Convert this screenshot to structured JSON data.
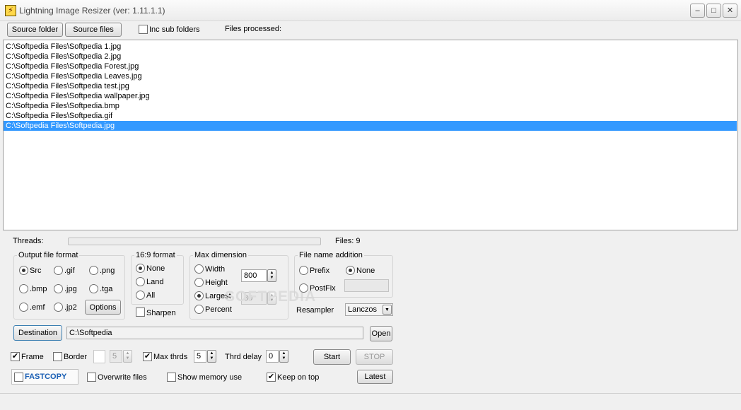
{
  "window": {
    "title": "Lightning Image Resizer (ver: 1.11.1.1)",
    "app_icon_glyph": "⚡",
    "minimize_glyph": "–",
    "maximize_glyph": "□",
    "close_glyph": "✕"
  },
  "toolbar": {
    "source_folder_label": "Source folder",
    "source_files_label": "Source files",
    "inc_sub_folders_label": "Inc sub folders",
    "inc_sub_folders_checked": false,
    "files_processed_label": "Files processed:"
  },
  "file_list": {
    "items": [
      "C:\\Softpedia Files\\Softpedia 1.jpg",
      "C:\\Softpedia Files\\Softpedia 2.jpg",
      "C:\\Softpedia Files\\Softpedia Forest.jpg",
      "C:\\Softpedia Files\\Softpedia Leaves.jpg",
      "C:\\Softpedia Files\\Softpedia test.jpg",
      "C:\\Softpedia Files\\Softpedia wallpaper.jpg",
      "C:\\Softpedia Files\\Softpedia.bmp",
      "C:\\Softpedia Files\\Softpedia.gif",
      "C:\\Softpedia Files\\Softpedia.jpg"
    ],
    "selected_index": 8,
    "selection_color": "#3399ff"
  },
  "status": {
    "threads_label": "Threads:",
    "threads_progress": 0,
    "files_label": "Files: 9"
  },
  "output_format": {
    "title": "Output file format",
    "options": [
      ".gif",
      ".png",
      ".bmp",
      ".jpg",
      ".tga",
      ".emf",
      ".jp2"
    ],
    "src_label": "Src",
    "selected": "Src",
    "options_button": "Options"
  },
  "aspect": {
    "title": "16:9 format",
    "none_label": "None",
    "land_label": "Land",
    "all_label": "All",
    "selected": "None",
    "sharpen_label": "Sharpen",
    "sharpen_checked": false
  },
  "max_dimension": {
    "title": "Max dimension",
    "width_label": "Width",
    "height_label": "Height",
    "largest_label": "Largest",
    "percent_label": "Percent",
    "selected": "Largest",
    "size_value": "800",
    "percent_value": "80"
  },
  "filename_addition": {
    "title": "File name addition",
    "prefix_label": "Prefix",
    "postfix_label": "PostFix",
    "none_label": "None",
    "selected": "None",
    "text_value": ""
  },
  "resampler": {
    "label": "Resampler",
    "value": "Lanczos"
  },
  "destination": {
    "button_label": "Destination",
    "path": "C:\\Softpedia",
    "open_label": "Open"
  },
  "options_row": {
    "frame_label": "Frame",
    "frame_checked": true,
    "border_label": "Border",
    "border_checked": false,
    "border_value": "5",
    "max_thrds_label": "Max thrds",
    "max_thrds_checked": true,
    "max_thrds_value": "5",
    "thrd_delay_label": "Thrd delay",
    "thrd_delay_value": "0",
    "start_label": "Start",
    "stop_label": "STOP"
  },
  "bottom_row": {
    "fastcopy_label": "FASTCOPY",
    "fastcopy_checked": false,
    "overwrite_label": "Overwrite files",
    "overwrite_checked": false,
    "memory_label": "Show memory use",
    "memory_checked": false,
    "keep_on_top_label": "Keep on top",
    "keep_on_top_checked": true,
    "latest_label": "Latest"
  },
  "icons": {
    "check_glyph": "✔",
    "spin_up": "▲",
    "spin_down": "▼",
    "dropdown_glyph": "▼"
  },
  "watermark": "SOFTPEDIA"
}
